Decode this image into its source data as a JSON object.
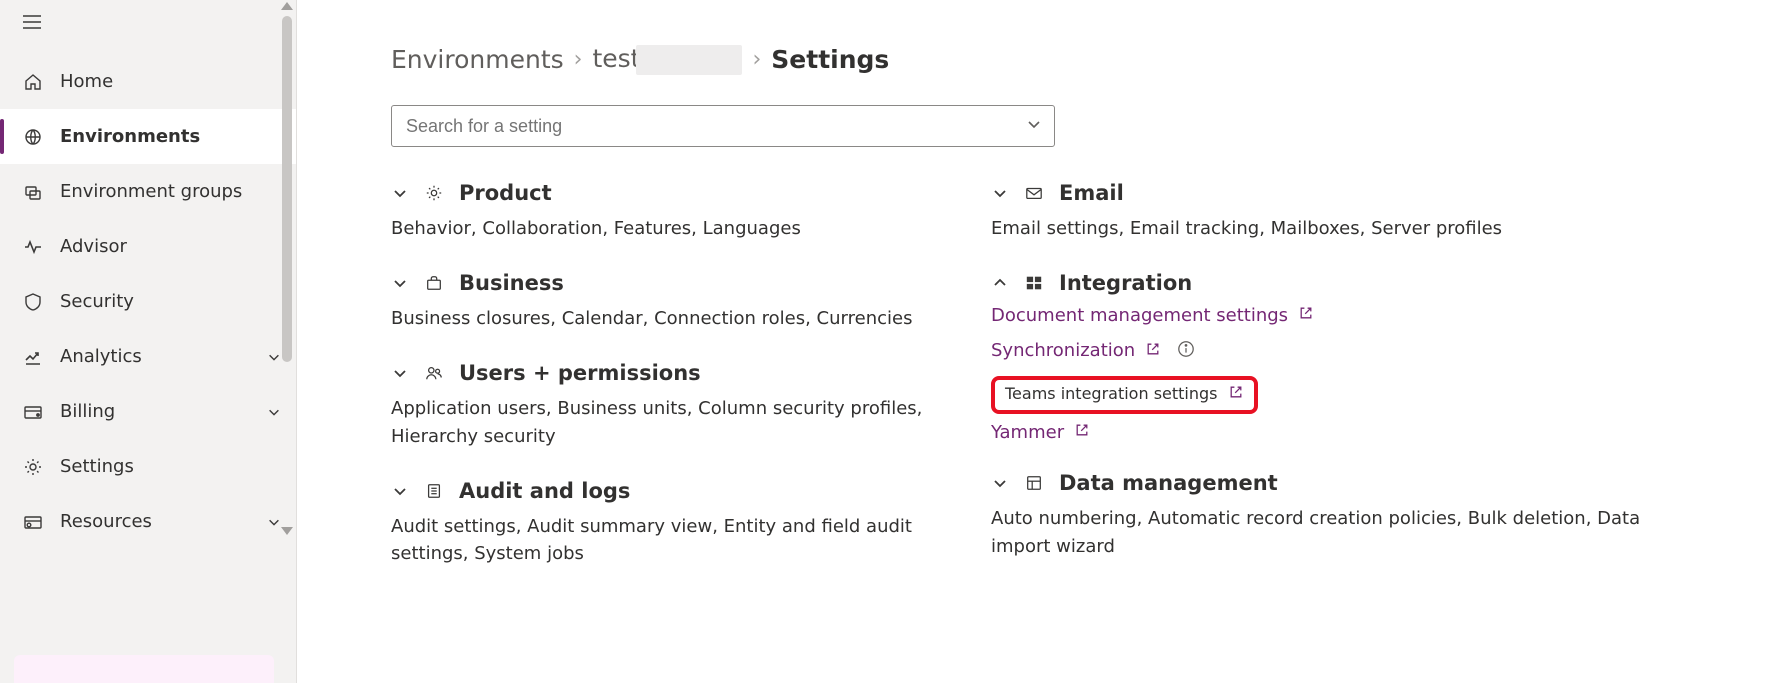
{
  "sidebar": {
    "items": [
      {
        "label": "Home"
      },
      {
        "label": "Environments"
      },
      {
        "label": "Environment groups"
      },
      {
        "label": "Advisor"
      },
      {
        "label": "Security"
      },
      {
        "label": "Analytics"
      },
      {
        "label": "Billing"
      },
      {
        "label": "Settings"
      },
      {
        "label": "Resources"
      }
    ]
  },
  "breadcrumb": {
    "env_root": "Environments",
    "env_name": "test",
    "page": "Settings"
  },
  "search": {
    "placeholder": "Search for a setting"
  },
  "categories": {
    "product": {
      "title": "Product",
      "sub": "Behavior, Collaboration, Features, Languages"
    },
    "business": {
      "title": "Business",
      "sub": "Business closures, Calendar, Connection roles, Currencies"
    },
    "users": {
      "title": "Users + permissions",
      "sub": "Application users, Business units, Column security profiles, Hierarchy security"
    },
    "audit": {
      "title": "Audit and logs",
      "sub": "Audit settings, Audit summary view, Entity and field audit settings, System jobs"
    },
    "email": {
      "title": "Email",
      "sub": "Email settings, Email tracking, Mailboxes, Server profiles"
    },
    "integration": {
      "title": "Integration",
      "links": {
        "doc": "Document management settings",
        "sync": "Synchronization",
        "teams": "Teams integration settings",
        "yammer": "Yammer"
      }
    },
    "datamgmt": {
      "title": "Data management",
      "sub": "Auto numbering, Automatic record creation policies, Bulk deletion, Data import wizard"
    }
  }
}
